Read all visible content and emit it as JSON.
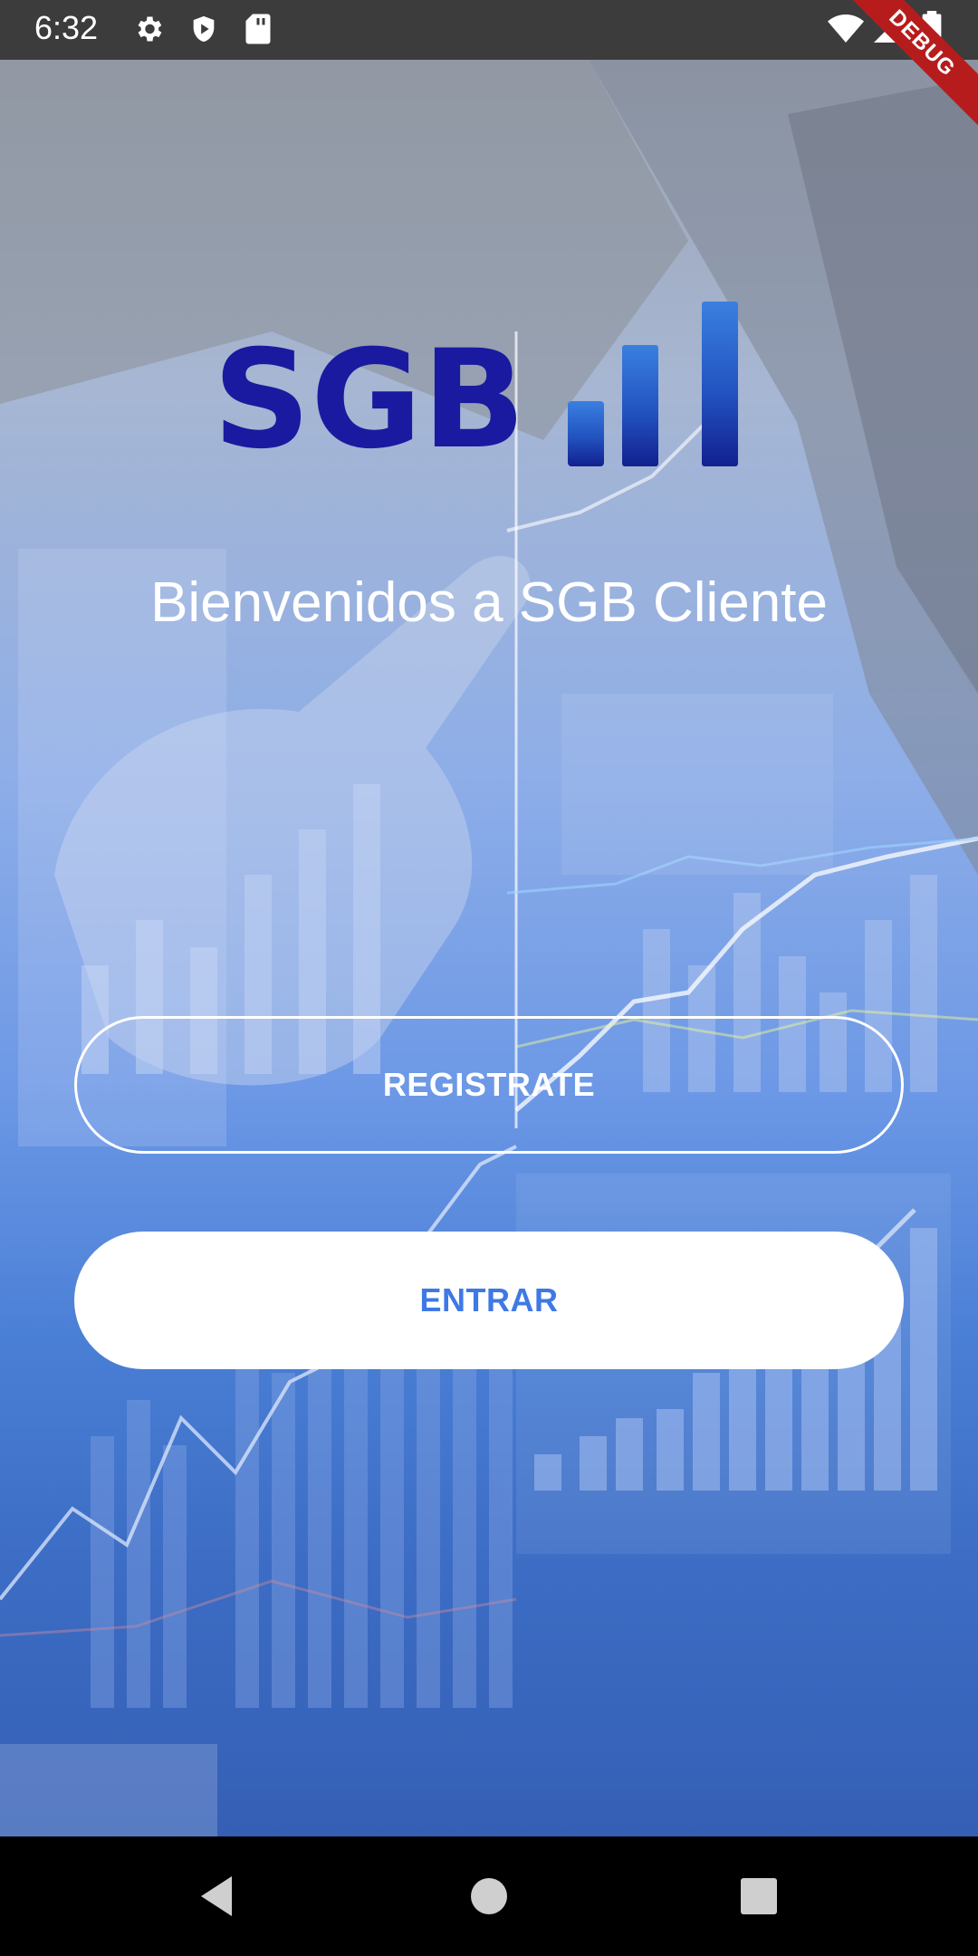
{
  "status_bar": {
    "time": "6:32",
    "icons": [
      "settings-icon",
      "shield-icon",
      "sd-card-icon",
      "wifi-icon",
      "signal-icon",
      "battery-icon"
    ],
    "debug_label": "DEBUG"
  },
  "logo": {
    "text": "SGB"
  },
  "welcome": {
    "title": "Bienvenidos a SGB Cliente"
  },
  "buttons": {
    "register_label": "REGISTRATE",
    "enter_label": "ENTRAR"
  },
  "nav_bar": {
    "icons": [
      "back-icon",
      "home-icon",
      "recents-icon"
    ]
  },
  "colors": {
    "accent": "#3e79e5",
    "debug": "#b71c1c"
  }
}
